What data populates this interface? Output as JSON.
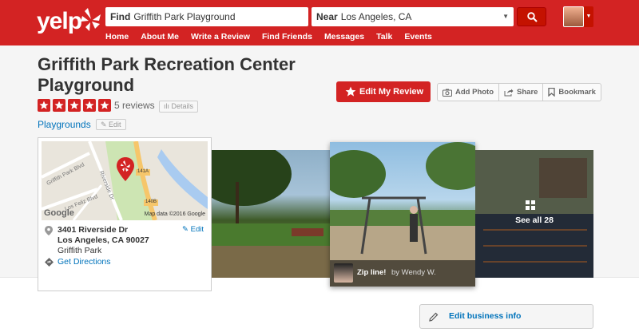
{
  "header": {
    "logo_text": "yelp",
    "find_label": "Find",
    "find_value": "Griffith Park Playground",
    "near_label": "Near",
    "near_value": "Los Angeles, CA",
    "nav": [
      "Home",
      "About Me",
      "Write a Review",
      "Find Friends",
      "Messages",
      "Talk",
      "Events"
    ],
    "brand_color": "#d32323"
  },
  "business": {
    "name": "Griffith Park Recreation Center Playground",
    "rating_stars": 5,
    "review_count": "5 reviews",
    "details_label": "Details",
    "category": "Playgrounds",
    "edit_label": "Edit"
  },
  "actions": {
    "edit_review": "Edit My Review",
    "add_photo": "Add Photo",
    "share": "Share",
    "bookmark": "Bookmark"
  },
  "map": {
    "google": "Google",
    "map_data": "Map data ©2016 Google",
    "roads": [
      "Griffith Park Blvd",
      "Riverside Dr",
      "Los Feliz Blvd"
    ],
    "shields": [
      "141A",
      "140B"
    ]
  },
  "address": {
    "line1": "3401 Riverside Dr",
    "line2": "Los Angeles, CA 90027",
    "neighborhood": "Griffith Park",
    "edit": "Edit",
    "directions": "Get Directions"
  },
  "photos": {
    "caption_title": "Zip line!",
    "caption_by": "by Wendy W.",
    "see_all": "See all 28"
  },
  "sidebar": {
    "edit_business": "Edit business info"
  }
}
